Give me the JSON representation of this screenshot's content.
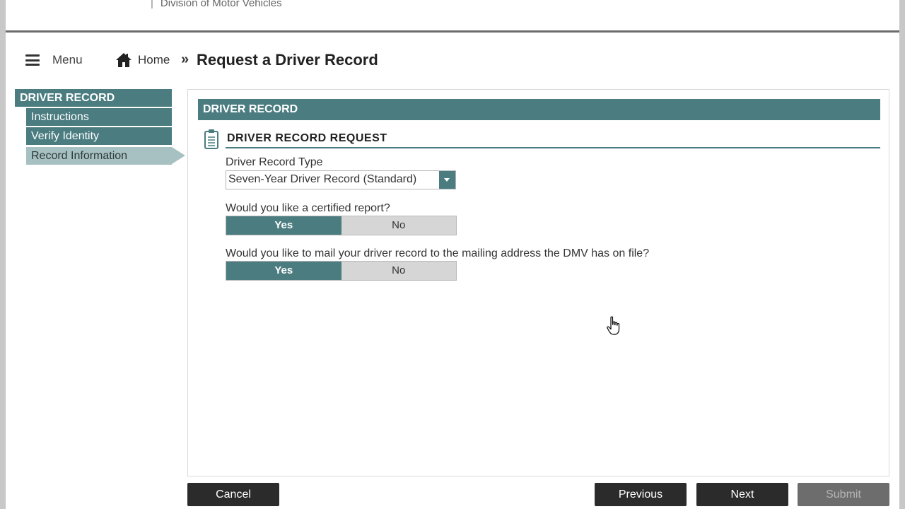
{
  "header": {
    "division_text": "Division of Motor Vehicles"
  },
  "topbar": {
    "menu_label": "Menu",
    "home_label": "Home",
    "separator": "»",
    "page_title": "Request a Driver Record"
  },
  "sidebar": {
    "heading": "DRIVER RECORD",
    "items": [
      {
        "label": "Instructions",
        "active": false
      },
      {
        "label": "Verify Identity",
        "active": false
      },
      {
        "label": "Record Information",
        "active": true
      }
    ]
  },
  "main": {
    "section_title": "DRIVER RECORD",
    "subsection_title": "DRIVER RECORD REQUEST",
    "record_type": {
      "label": "Driver Record Type",
      "selected": "Seven-Year Driver Record (Standard)"
    },
    "certified": {
      "question": "Would you like a certified report?",
      "yes_label": "Yes",
      "no_label": "No",
      "selected": "Yes"
    },
    "mail": {
      "question": "Would you like to mail your driver record to the mailing address the DMV has on file?",
      "yes_label": "Yes",
      "no_label": "No",
      "selected": "Yes"
    }
  },
  "footer": {
    "cancel_label": "Cancel",
    "previous_label": "Previous",
    "next_label": "Next",
    "submit_label": "Submit"
  },
  "colors": {
    "accent": "#4a7c80",
    "active_nav": "#a7c0c2",
    "button_dark": "#2b2b2b"
  }
}
